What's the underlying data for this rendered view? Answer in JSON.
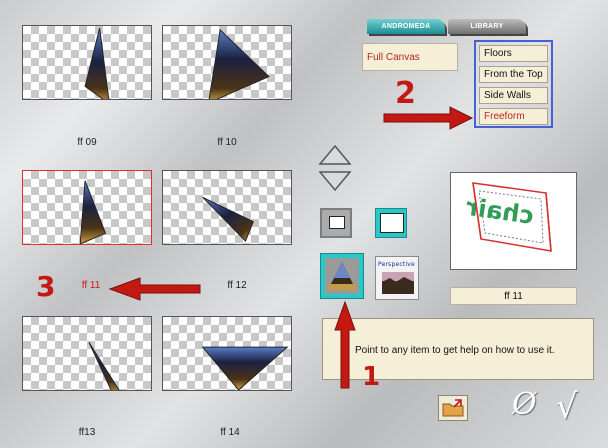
{
  "tabs": {
    "andromeda": "ANDROMEDA",
    "library": "LIBRARY"
  },
  "full_canvas": "Full Canvas",
  "menu_items": [
    "Floors",
    "From the Top",
    "Side Walls",
    "Freeform"
  ],
  "active_menu_item": "Freeform",
  "thumbnails": [
    {
      "label": "ff 09",
      "selected": false
    },
    {
      "label": "ff 10",
      "selected": false
    },
    {
      "label": "ff 11",
      "selected": true
    },
    {
      "label": "ff 12",
      "selected": false
    },
    {
      "label": "ff13",
      "selected": false
    },
    {
      "label": "ff 14",
      "selected": false
    }
  ],
  "mode_buttons": {
    "perspective_label": "Perspective"
  },
  "preview": {
    "logo_text": "chair"
  },
  "selected_item_name": "ff 11",
  "help_text": "Point to any item to get help on how to use it.",
  "action_glyphs": {
    "cancel": "Ø",
    "ok": "√"
  },
  "annotations": {
    "one": "1",
    "two": "2",
    "three": "3"
  },
  "colors": {
    "accent_teal": "#2bc6c6",
    "highlight_red": "#e0302c",
    "menu_border": "#4a5fd0",
    "panel_cream": "#f5efd8"
  }
}
